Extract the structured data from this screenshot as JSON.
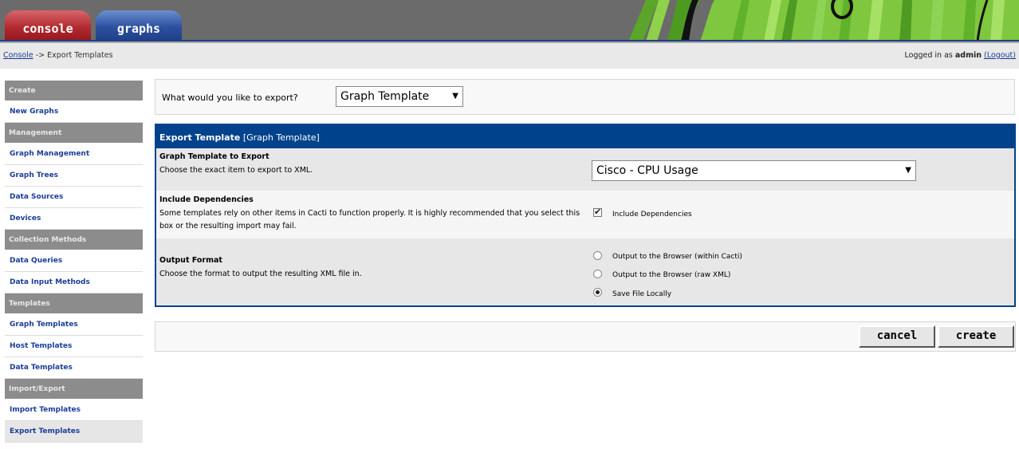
{
  "header": {
    "tabs": [
      {
        "label": "console"
      },
      {
        "label": "graphs"
      }
    ]
  },
  "navbar": {
    "breadcrumb_link": "Console",
    "breadcrumb_sep": " -> ",
    "breadcrumb_current": "Export Templates",
    "login_prefix": "Logged in as ",
    "login_user": "admin",
    "logout_label": "(Logout)"
  },
  "sidebar": {
    "sections": [
      {
        "header": "Create",
        "items": [
          "New Graphs"
        ]
      },
      {
        "header": "Management",
        "items": [
          "Graph Management",
          "Graph Trees",
          "Data Sources",
          "Devices"
        ]
      },
      {
        "header": "Collection Methods",
        "items": [
          "Data Queries",
          "Data Input Methods"
        ]
      },
      {
        "header": "Templates",
        "items": [
          "Graph Templates",
          "Host Templates",
          "Data Templates"
        ]
      },
      {
        "header": "Import/Export",
        "items": [
          "Import Templates",
          "Export Templates"
        ]
      }
    ],
    "active_item": "Export Templates"
  },
  "export_selector": {
    "question": "What would you like to export?",
    "selected": "Graph Template"
  },
  "form": {
    "header_title": "Export Template",
    "header_sub": "[Graph Template]",
    "template_title": "Graph Template to Export",
    "template_desc": "Choose the exact item to export to XML.",
    "template_selected": "Cisco - CPU Usage",
    "deps_title": "Include Dependencies",
    "deps_desc": "Some templates rely on other items in Cacti to function properly. It is highly recommended that you select this box or the resulting import may fail.",
    "deps_checkbox_label": "Include Dependencies",
    "deps_checked": true,
    "format_title": "Output Format",
    "format_desc": "Choose the format to output the resulting XML file in.",
    "format_options": [
      {
        "label": "Output to the Browser (within Cacti)",
        "checked": false
      },
      {
        "label": "Output to the Browser (raw XML)",
        "checked": false
      },
      {
        "label": "Save File Locally",
        "checked": true
      }
    ]
  },
  "actions": {
    "cancel_label": "cancel",
    "create_label": "create"
  },
  "colors": {
    "form_header": "#00438c",
    "link": "#1a3d98",
    "menu_header": "#8c8c8c",
    "console_tab": "#b12a30",
    "graphs_tab": "#2c4f9e"
  }
}
